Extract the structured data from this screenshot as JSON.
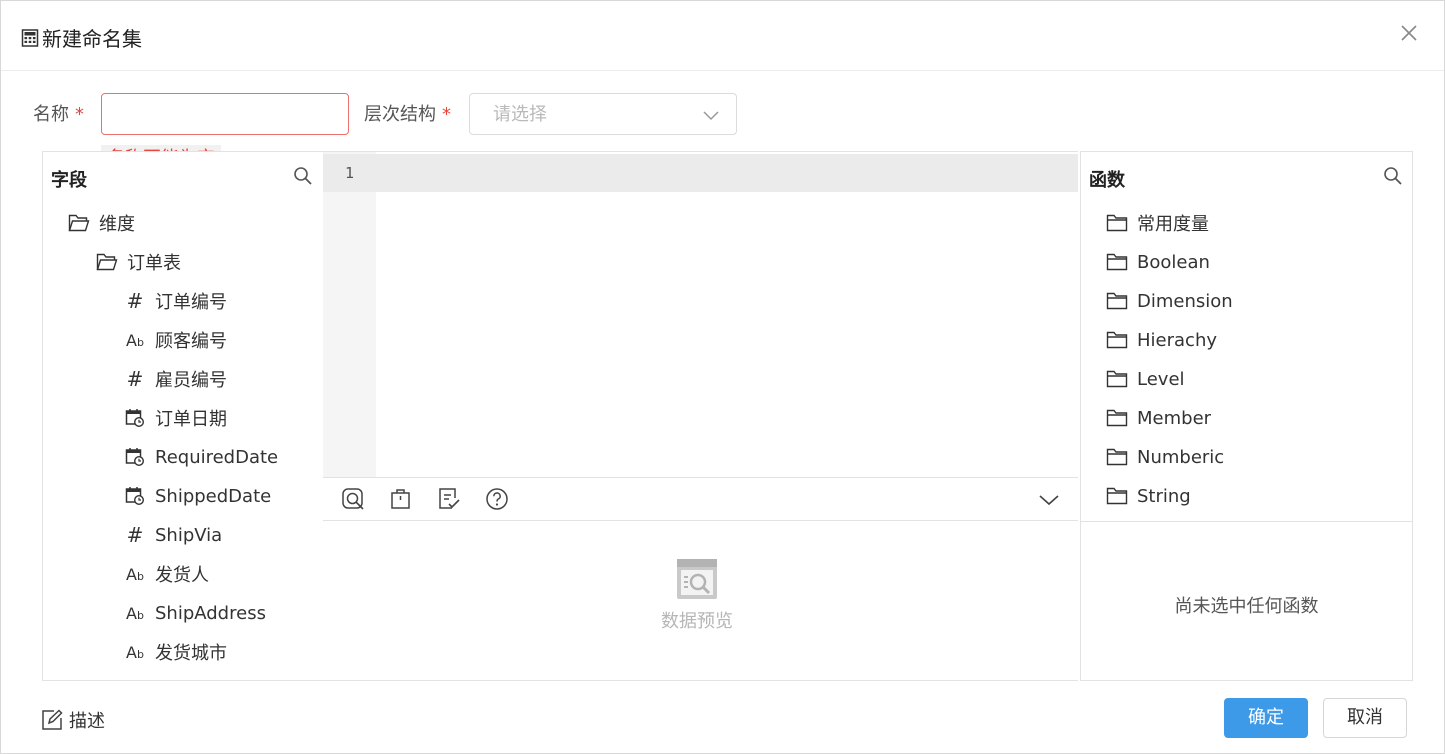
{
  "dialog": {
    "title": "新建命名集",
    "title_icon": "calculator-icon",
    "close_icon": "close-icon"
  },
  "form": {
    "name_label": "名称",
    "required_mark": "*",
    "name_value": "",
    "name_error": "名称不能为空",
    "hierarchy_label": "层次结构",
    "hierarchy_placeholder": "请选择"
  },
  "fields_panel": {
    "title": "字段",
    "tree": [
      {
        "label": "维度",
        "icon": "folder-open-icon",
        "level": 0
      },
      {
        "label": "订单表",
        "icon": "folder-open-icon",
        "level": 1
      },
      {
        "label": "订单编号",
        "icon": "number-icon",
        "level": 2
      },
      {
        "label": "顾客编号",
        "icon": "text-field-icon",
        "level": 2
      },
      {
        "label": "雇员编号",
        "icon": "number-icon",
        "level": 2
      },
      {
        "label": "订单日期",
        "icon": "date-field-icon",
        "level": 2
      },
      {
        "label": "RequiredDate",
        "icon": "date-field-icon",
        "level": 2
      },
      {
        "label": "ShippedDate",
        "icon": "date-field-icon",
        "level": 2
      },
      {
        "label": "ShipVia",
        "icon": "number-icon",
        "level": 2
      },
      {
        "label": "发货人",
        "icon": "text-field-icon",
        "level": 2
      },
      {
        "label": "ShipAddress",
        "icon": "text-field-icon",
        "level": 2
      },
      {
        "label": "发货城市",
        "icon": "text-field-icon",
        "level": 2
      }
    ],
    "text_glyph": "Ab",
    "number_glyph": "#"
  },
  "editor": {
    "line_numbers": [
      "1"
    ]
  },
  "preview": {
    "text": "数据预览"
  },
  "functions_panel": {
    "title": "函数",
    "items": [
      "常用度量",
      "Boolean",
      "Dimension",
      "Hierachy",
      "Level",
      "Member",
      "Numberic",
      "String"
    ],
    "empty_text": "尚未选中任何函数"
  },
  "footer": {
    "desc_label": "描述",
    "ok_label": "确定",
    "cancel_label": "取消"
  },
  "colors": {
    "primary": "#3d9ae8",
    "error": "#e8443c"
  }
}
